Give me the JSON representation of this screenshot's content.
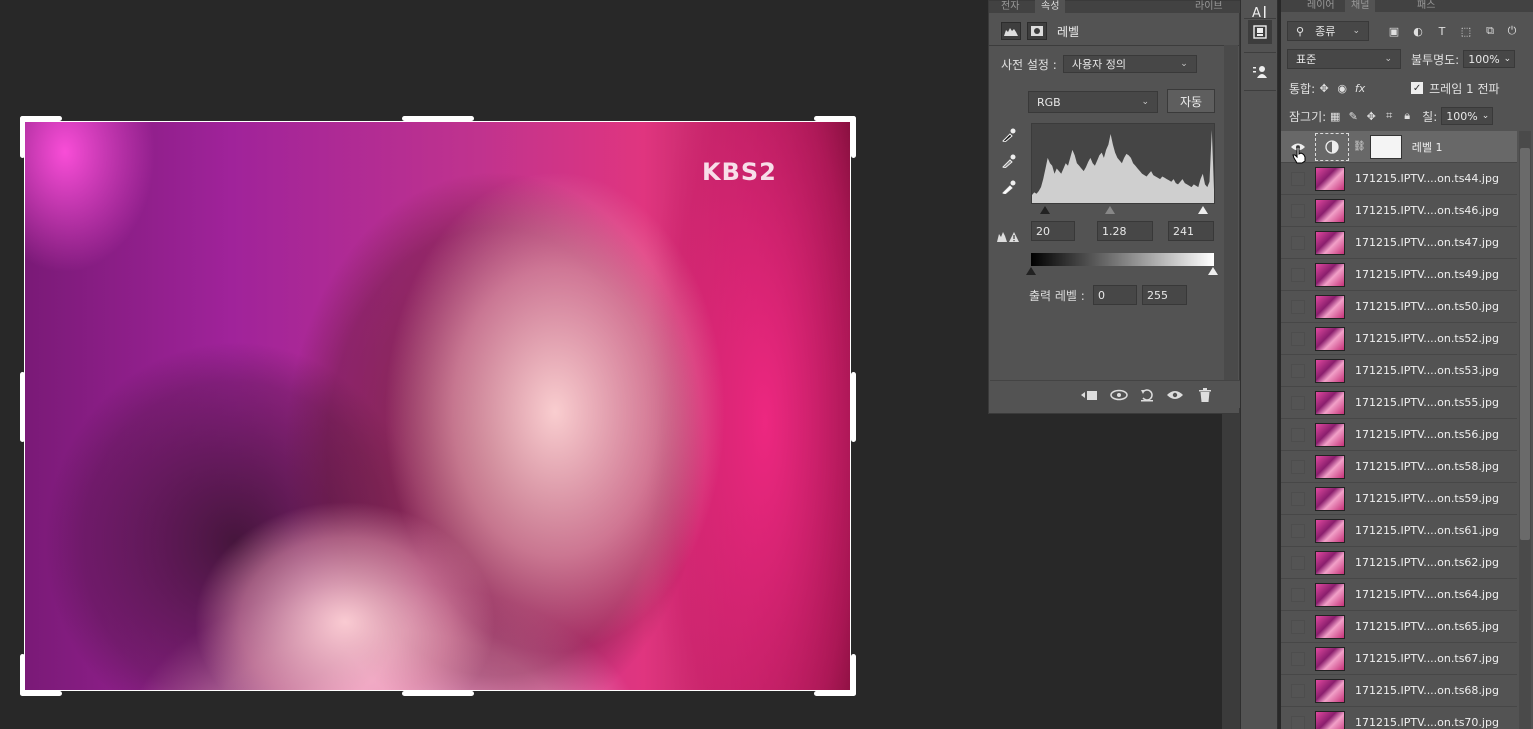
{
  "canvas": {
    "watermark": "KBS2"
  },
  "properties": {
    "tabs": [
      "전자",
      "속성",
      "라이브"
    ],
    "title": "레벨",
    "preset_label": "사전 설정 :",
    "preset_value": "사용자 정의",
    "channel_value": "RGB",
    "auto_label": "자동",
    "input_black": "20",
    "input_gamma": "1.28",
    "input_white": "241",
    "output_label": "출력 레벨 :",
    "output_black": "0",
    "output_white": "255",
    "histogram": [
      6,
      8,
      7,
      9,
      12,
      18,
      26,
      34,
      30,
      28,
      22,
      26,
      24,
      22,
      26,
      30,
      28,
      34,
      40,
      36,
      30,
      28,
      26,
      24,
      27,
      31,
      34,
      30,
      28,
      32,
      36,
      38,
      34,
      40,
      44,
      52,
      44,
      38,
      34,
      32,
      30,
      34,
      37,
      36,
      34,
      30,
      28,
      26,
      24,
      22,
      21,
      20,
      22,
      24,
      21,
      20,
      19,
      18,
      20,
      19,
      18,
      17,
      16,
      18,
      15,
      14,
      16,
      18,
      15,
      14,
      13,
      12,
      14,
      13,
      12,
      18,
      22,
      14,
      12,
      16,
      55,
      10
    ]
  },
  "dock": {
    "icons": [
      "character-icon",
      "3d-icon",
      "layer-comps-icon"
    ]
  },
  "layers": {
    "tabs": [
      "레이어",
      "채널",
      "패스"
    ],
    "filter_kind": "종류",
    "blend_mode": "표준",
    "opacity_label": "불투명도:",
    "opacity_value": "100%",
    "unify_label": "통합:",
    "propagate_label": "프레임 1 전파",
    "lock_label": "잠그기:",
    "fill_label": "칠:",
    "fill_value": "100%",
    "adjustment_layer": "레벨 1",
    "items": [
      "171215.IPTV....on.ts44.jpg",
      "171215.IPTV....on.ts46.jpg",
      "171215.IPTV....on.ts47.jpg",
      "171215.IPTV....on.ts49.jpg",
      "171215.IPTV....on.ts50.jpg",
      "171215.IPTV....on.ts52.jpg",
      "171215.IPTV....on.ts53.jpg",
      "171215.IPTV....on.ts55.jpg",
      "171215.IPTV....on.ts56.jpg",
      "171215.IPTV....on.ts58.jpg",
      "171215.IPTV....on.ts59.jpg",
      "171215.IPTV....on.ts61.jpg",
      "171215.IPTV....on.ts62.jpg",
      "171215.IPTV....on.ts64.jpg",
      "171215.IPTV....on.ts65.jpg",
      "171215.IPTV....on.ts67.jpg",
      "171215.IPTV....on.ts68.jpg",
      "171215.IPTV....on.ts70.jpg"
    ]
  }
}
